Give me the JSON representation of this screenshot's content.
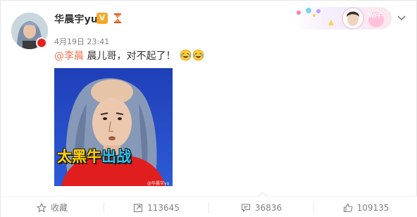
{
  "post": {
    "username": "华晨宇yu",
    "timestamp": "4月19日 23:41",
    "mention": "@李晨",
    "text": "晨儿哥，对不起了！",
    "emoji_name": "laughing-tears-emoji"
  },
  "image": {
    "caption_part1": "太黑牛",
    "caption_part2": "出战",
    "watermark": "@华晨宇yu"
  },
  "badges": {
    "verified_label": "V",
    "verified_color": "#f6a623",
    "rank_icon": "rank-hourglass-icon"
  },
  "decoration": {
    "label": "WFF"
  },
  "actions": {
    "favorite_label": "收藏",
    "repost_count": "113645",
    "comment_count": "36836",
    "like_count": "109135"
  },
  "colors": {
    "mention": "#eb7350",
    "caption_yellow": "#ffd400",
    "caption_blue": "#27c3f2",
    "meta_gray": "#808080"
  }
}
